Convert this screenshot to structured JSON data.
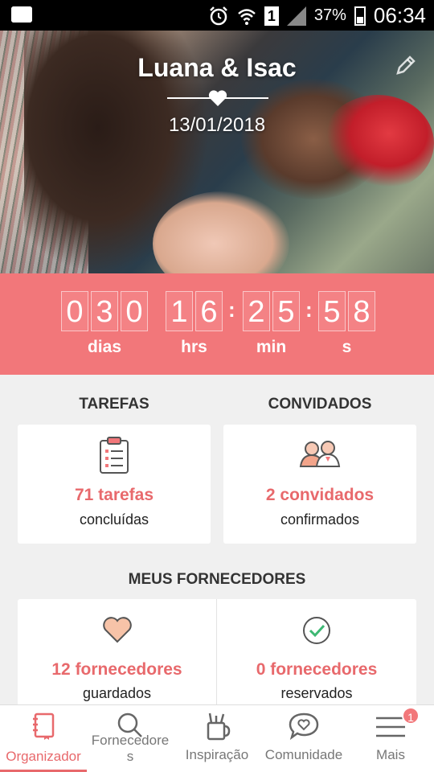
{
  "status_bar": {
    "battery": "37%",
    "time": "06:34",
    "sim": "1"
  },
  "hero": {
    "couple": "Luana & Isac",
    "date": "13/01/2018"
  },
  "countdown": {
    "days": [
      "0",
      "3",
      "0"
    ],
    "hours": [
      "1",
      "6"
    ],
    "minutes": [
      "2",
      "5"
    ],
    "seconds": [
      "5",
      "8"
    ],
    "labels": {
      "days": "dias",
      "hours": "hrs",
      "minutes": "min",
      "seconds": "s"
    }
  },
  "tasks": {
    "title": "TAREFAS",
    "count": "71 tarefas",
    "status": "concluídas"
  },
  "guests": {
    "title": "CONVIDADOS",
    "count": "2 convidados",
    "status": "confirmados"
  },
  "vendors": {
    "title": "MEUS FORNECEDORES",
    "saved_count": "12 fornecedores",
    "saved_label": "guardados",
    "booked_count": "0 fornecedores",
    "booked_label": "reservados"
  },
  "nav": {
    "items": [
      {
        "label": "Organizador",
        "icon": "notebook-icon",
        "active": true
      },
      {
        "label": "Fornecedores",
        "icon": "search-icon"
      },
      {
        "label": "Inspiração",
        "icon": "pencil-cup-icon"
      },
      {
        "label": "Comunidade",
        "icon": "chat-heart-icon"
      },
      {
        "label": "Mais",
        "icon": "menu-icon"
      }
    ],
    "badge": "1"
  },
  "colors": {
    "accent": "#f2777a",
    "accent_text": "#e8696c"
  }
}
